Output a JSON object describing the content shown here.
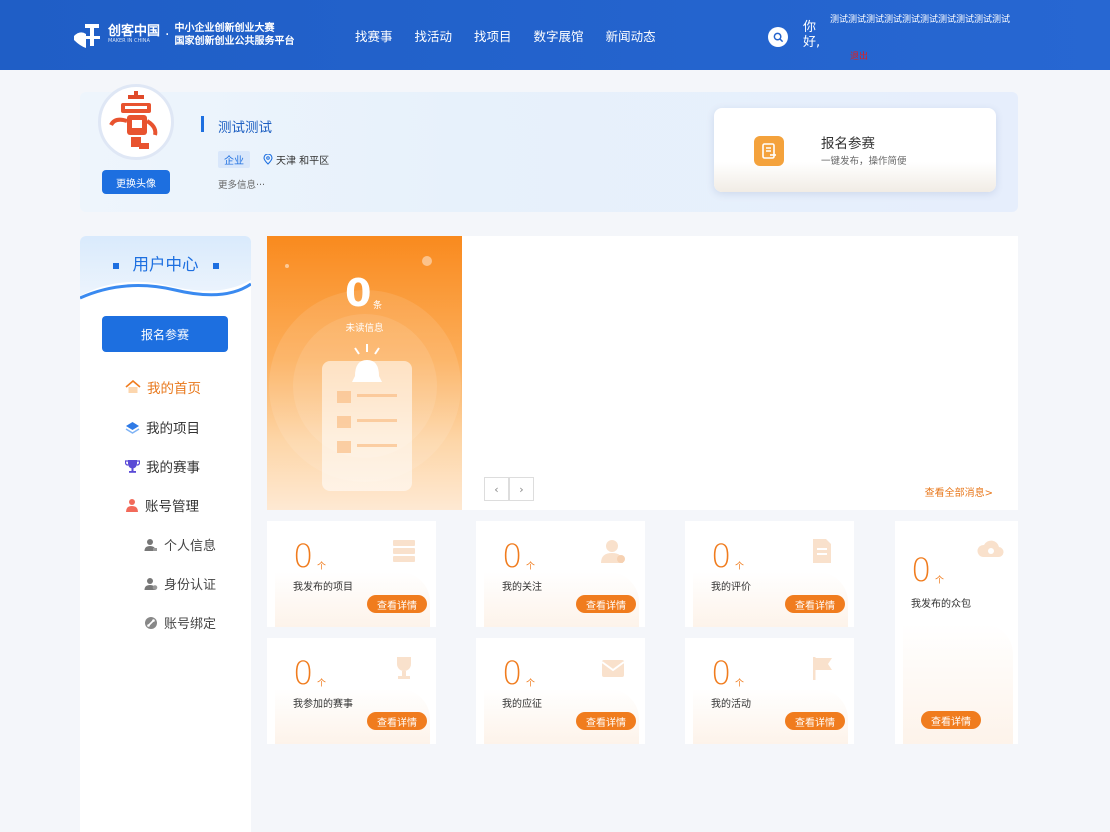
{
  "header": {
    "logo_brand": "创客中国",
    "logo_brand_en": "MAKER IN CHINA",
    "logo_dot": "·",
    "logo_line1": "中小企业创新创业大赛",
    "logo_line2": "国家创新创业公共服务平台",
    "nav": [
      "找赛事",
      "找活动",
      "找项目",
      "数字展馆",
      "新闻动态"
    ],
    "greeting": "你好,",
    "username": "测试测试测试测试测试测试测试测试测试测试",
    "logout": "退出"
  },
  "profile": {
    "change_avatar": "更换头像",
    "name": "测试测试",
    "type": "企业",
    "location": "天津 和平区",
    "more": "更多信息···",
    "signup_title": "报名参赛",
    "signup_desc": "一键发布，操作简便"
  },
  "sidebar": {
    "title": "用户中心",
    "button": "报名参赛",
    "menu": [
      {
        "label": "我的首页",
        "icon": "home-icon"
      },
      {
        "label": "我的项目",
        "icon": "layers-icon"
      },
      {
        "label": "我的赛事",
        "icon": "trophy-icon"
      },
      {
        "label": "账号管理",
        "icon": "user-icon"
      }
    ],
    "submenu": [
      {
        "label": "个人信息",
        "icon": "person-icon"
      },
      {
        "label": "身份认证",
        "icon": "id-icon"
      },
      {
        "label": "账号绑定",
        "icon": "link-icon"
      }
    ]
  },
  "messages": {
    "count": "0",
    "unit": "条",
    "label": "未读信息",
    "prev": "‹",
    "next": "›",
    "view_all": "查看全部消息>"
  },
  "cards": [
    {
      "num": "0",
      "unit": "个",
      "label": "我发布的项目",
      "btn": "查看详情"
    },
    {
      "num": "0",
      "unit": "个",
      "label": "我的关注",
      "btn": "查看详情"
    },
    {
      "num": "0",
      "unit": "个",
      "label": "我的评价",
      "btn": "查看详情"
    },
    {
      "num": "0",
      "unit": "个",
      "label": "我发布的众包",
      "btn": "查看详情"
    },
    {
      "num": "0",
      "unit": "个",
      "label": "我参加的赛事",
      "btn": "查看详情"
    },
    {
      "num": "0",
      "unit": "个",
      "label": "我的应征",
      "btn": "查看详情"
    },
    {
      "num": "0",
      "unit": "个",
      "label": "我的活动",
      "btn": "查看详情"
    }
  ],
  "colors": {
    "header_blue": "#2362cc",
    "accent_orange": "#f07c1e",
    "primary_blue": "#1d6fe0"
  }
}
